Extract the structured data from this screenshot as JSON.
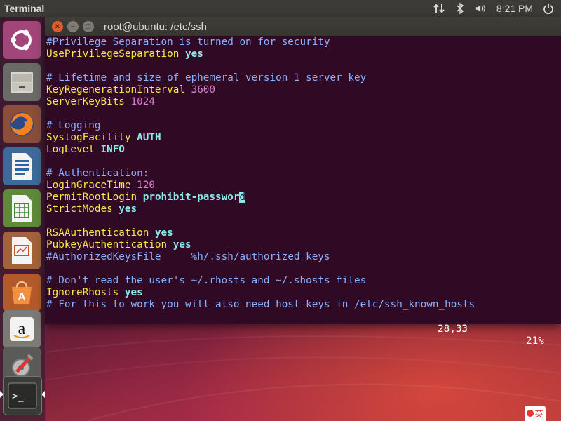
{
  "panel": {
    "app_title": "Terminal",
    "clock": "8:21 PM",
    "icons": [
      "network-icon",
      "bluetooth-icon",
      "volume-icon",
      "power-icon"
    ]
  },
  "launcher": {
    "items": [
      {
        "name": "ubuntu-dash",
        "icon": "ubuntu-logo-icon"
      },
      {
        "name": "files",
        "icon": "files-icon"
      },
      {
        "name": "firefox",
        "icon": "firefox-icon"
      },
      {
        "name": "writer",
        "icon": "writer-icon"
      },
      {
        "name": "calc",
        "icon": "calc-icon"
      },
      {
        "name": "impress",
        "icon": "impress-icon"
      },
      {
        "name": "software",
        "icon": "software-center-icon"
      },
      {
        "name": "amazon",
        "icon": "amazon-icon"
      },
      {
        "name": "settings",
        "icon": "system-settings-icon"
      },
      {
        "name": "terminal",
        "icon": "terminal-icon"
      }
    ],
    "amazon_letter": "a",
    "terminal_prompt": ">_",
    "software_letter": "A"
  },
  "window": {
    "title": "root@ubuntu: /etc/ssh",
    "close_glyph": "×",
    "min_glyph": "–",
    "max_glyph": "□"
  },
  "terminal": {
    "lines": [
      [
        {
          "t": "#Privilege Separation is turned on for security",
          "c": "comment"
        }
      ],
      [
        {
          "t": "UsePrivilegeSeparation",
          "c": "key"
        },
        {
          "t": " "
        },
        {
          "t": "yes",
          "c": "val"
        }
      ],
      [],
      [
        {
          "t": "# Lifetime and size of ephemeral version 1 server key",
          "c": "comment"
        }
      ],
      [
        {
          "t": "KeyRegenerationInterval",
          "c": "key"
        },
        {
          "t": " "
        },
        {
          "t": "3600",
          "c": "num"
        }
      ],
      [
        {
          "t": "ServerKeyBits",
          "c": "key"
        },
        {
          "t": " "
        },
        {
          "t": "1024",
          "c": "num"
        }
      ],
      [],
      [
        {
          "t": "# Logging",
          "c": "comment"
        }
      ],
      [
        {
          "t": "SyslogFacility",
          "c": "key"
        },
        {
          "t": " "
        },
        {
          "t": "AUTH",
          "c": "val"
        }
      ],
      [
        {
          "t": "LogLevel",
          "c": "key"
        },
        {
          "t": " "
        },
        {
          "t": "INFO",
          "c": "val"
        }
      ],
      [],
      [
        {
          "t": "# Authentication:",
          "c": "comment"
        }
      ],
      [
        {
          "t": "LoginGraceTime",
          "c": "key"
        },
        {
          "t": " "
        },
        {
          "t": "120",
          "c": "num"
        }
      ],
      [
        {
          "t": "PermitRootLogin",
          "c": "key"
        },
        {
          "t": " "
        },
        {
          "t": "prohibit-passwor",
          "c": "val"
        },
        {
          "t": "d",
          "c": "cursor"
        }
      ],
      [
        {
          "t": "StrictModes",
          "c": "key"
        },
        {
          "t": " "
        },
        {
          "t": "yes",
          "c": "val"
        }
      ],
      [],
      [
        {
          "t": "RSAAuthentication",
          "c": "key"
        },
        {
          "t": " "
        },
        {
          "t": "yes",
          "c": "val"
        }
      ],
      [
        {
          "t": "PubkeyAuthentication",
          "c": "key"
        },
        {
          "t": " "
        },
        {
          "t": "yes",
          "c": "val"
        }
      ],
      [
        {
          "t": "#AuthorizedKeysFile",
          "c": "comment"
        },
        {
          "t": "     "
        },
        {
          "t": "%h/.ssh/authorized_keys",
          "c": "path"
        }
      ],
      [],
      [
        {
          "t": "# Don't read the user's ~/.rhosts and ~/.shosts files",
          "c": "comment"
        }
      ],
      [
        {
          "t": "IgnoreRhosts",
          "c": "key"
        },
        {
          "t": " "
        },
        {
          "t": "yes",
          "c": "val"
        }
      ],
      [
        {
          "t": "# For this to work you will also need host keys in /etc/ssh_known_hosts",
          "c": "comment"
        }
      ]
    ],
    "status_position": "28,33",
    "status_percent": "21%"
  },
  "tray": {
    "badge_text": "英"
  }
}
